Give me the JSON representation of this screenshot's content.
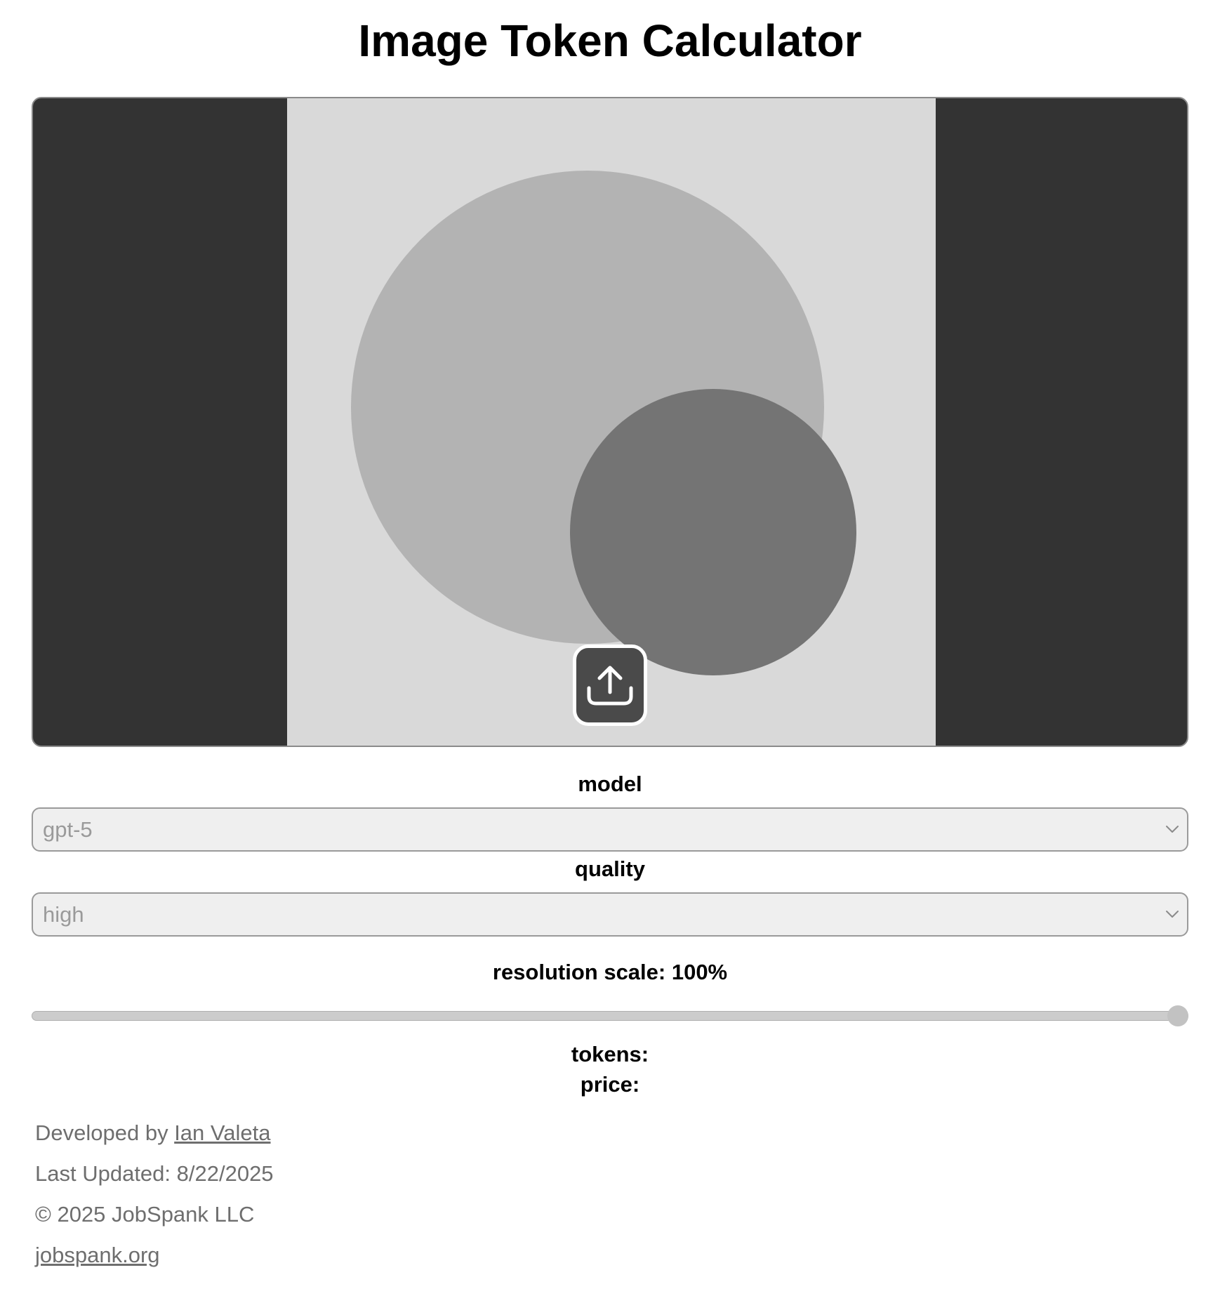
{
  "page": {
    "title": "Image Token Calculator"
  },
  "preview": {
    "upload_icon": "upload-icon",
    "colors": {
      "frame": "#333333",
      "canvas": "#d9d9d9",
      "large_circle": "#b3b3b3",
      "small_circle": "#747474",
      "upload_button": "#4a4a4a"
    }
  },
  "model": {
    "label": "model",
    "value": "gpt-5",
    "icon": "chevron-down-icon"
  },
  "quality": {
    "label": "quality",
    "value": "high",
    "icon": "chevron-down-icon"
  },
  "resolution": {
    "label": "resolution scale: 100%",
    "value_percent": 100
  },
  "results": {
    "tokens_label": "tokens:",
    "price_label": "price:"
  },
  "footer": {
    "developed_prefix": "Developed by ",
    "developer_name": "Ian Valeta",
    "last_updated": "Last Updated: 8/22/2025",
    "copyright": "© 2025 JobSpank LLC",
    "site_link": "jobspank.org"
  }
}
